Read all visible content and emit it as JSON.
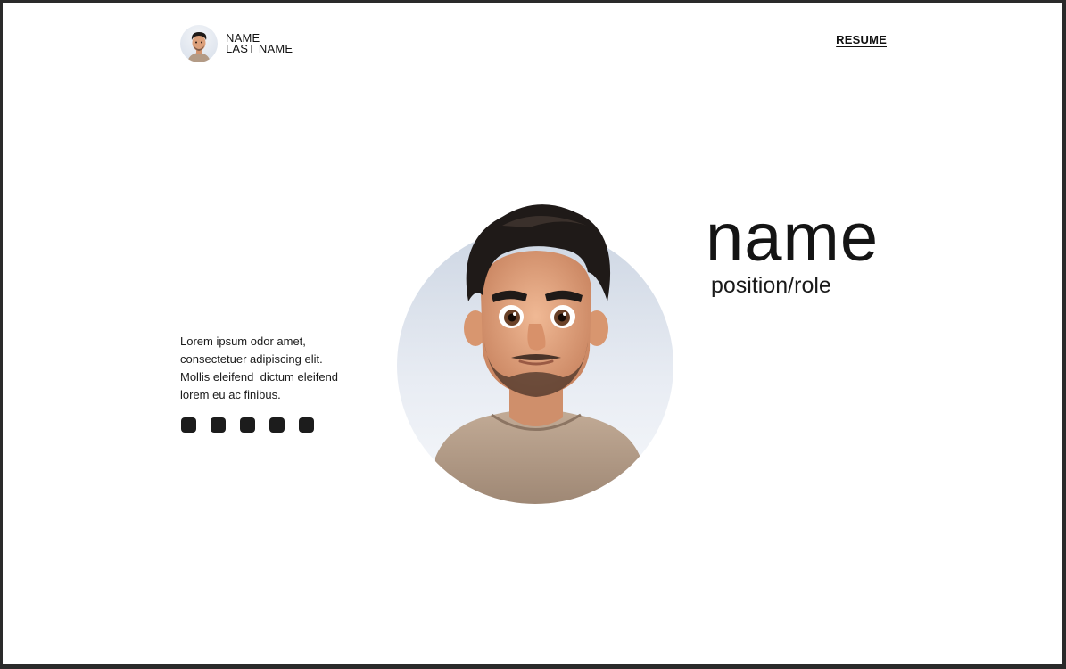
{
  "header": {
    "first_name": "NAME",
    "last_name": "LAST NAME",
    "resume_link": "RESUME"
  },
  "hero": {
    "name": "name",
    "role": "position/role"
  },
  "intro": {
    "lines": [
      "Lorem ipsum odor amet,",
      "consectetuer adipiscing elit.",
      "Mollis eleifend  dictum eleifend",
      "lorem eu ac finibus."
    ]
  },
  "social": {
    "icons": [
      "social-icon-1",
      "social-icon-2",
      "social-icon-3",
      "social-icon-4",
      "social-icon-5"
    ]
  },
  "colors": {
    "text": "#141414",
    "icon": "#1c1c1c",
    "skin": "#d99c78",
    "hair": "#1f1a18",
    "shirt": "#b39b86"
  }
}
